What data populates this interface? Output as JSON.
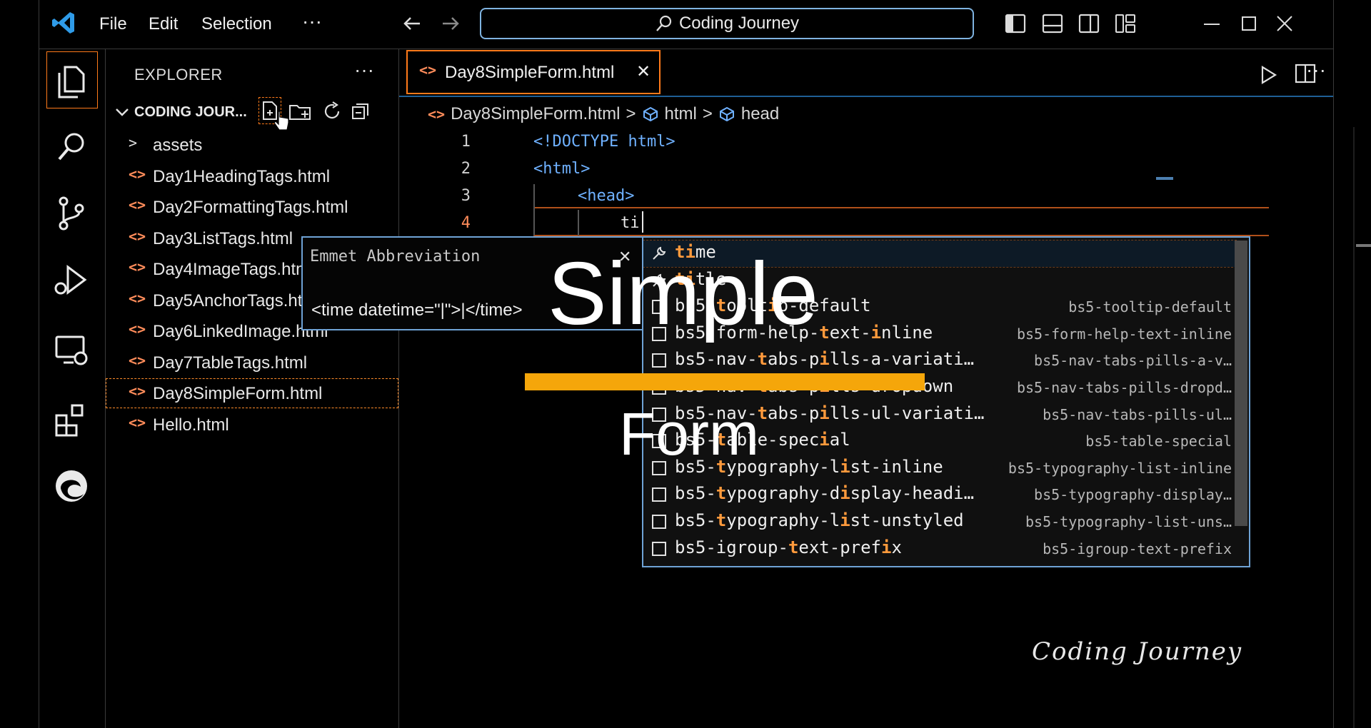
{
  "menu": {
    "file": "File",
    "edit": "Edit",
    "selection": "Selection",
    "more": "···"
  },
  "search": {
    "label": "Coding Journey"
  },
  "explorer": {
    "title": "EXPLORER",
    "more": "···",
    "workspace": "CODING JOUR...",
    "items": [
      {
        "label": "assets",
        "type": "folder"
      },
      {
        "label": "Day1HeadingTags.html",
        "type": "file"
      },
      {
        "label": "Day2FormattingTags.html",
        "type": "file"
      },
      {
        "label": "Day3ListTags.html",
        "type": "file"
      },
      {
        "label": "Day4ImageTags.html",
        "type": "file"
      },
      {
        "label": "Day5AnchorTags.html",
        "type": "file"
      },
      {
        "label": "Day6LinkedImage.html",
        "type": "file"
      },
      {
        "label": "Day7TableTags.html",
        "type": "file"
      },
      {
        "label": "Day8SimpleForm.html",
        "type": "file",
        "selected": true
      },
      {
        "label": "Hello.html",
        "type": "file"
      }
    ]
  },
  "editor": {
    "tab": {
      "label": "Day8SimpleForm.html",
      "close": "✕"
    },
    "breadcrumb": {
      "file": "Day8SimpleForm.html",
      "sep": ">",
      "node1": "html",
      "node2": "head"
    },
    "lines": [
      {
        "num": "1",
        "text": "<!DOCTYPE html>"
      },
      {
        "num": "2",
        "text": "<html>"
      },
      {
        "num": "3",
        "text": "<head>"
      },
      {
        "num": "4",
        "text": "ti"
      }
    ]
  },
  "emmet": {
    "title": "Emmet Abbreviation",
    "close": "✕",
    "preview": "<time datetime=\"|\">|</time>"
  },
  "suggestions": [
    {
      "label": "time",
      "detail": "",
      "icon": "wrench-icon"
    },
    {
      "label": "title",
      "detail": "",
      "icon": "wrench-icon"
    },
    {
      "label": "bs5-tooltip-default",
      "detail": "bs5-tooltip-default",
      "icon": "snippet-icon"
    },
    {
      "label": "bs5-form-help-text-inline",
      "detail": "bs5-form-help-text-inline",
      "icon": "snippet-icon"
    },
    {
      "label": "bs5-nav-tabs-pills-a-variati…",
      "detail": "bs5-nav-tabs-pills-a-v…",
      "icon": "snippet-icon"
    },
    {
      "label": "bs5-nav-tabs-pills-dropdown",
      "detail": "bs5-nav-tabs-pills-dropd…",
      "icon": "snippet-icon"
    },
    {
      "label": "bs5-nav-tabs-pills-ul-variati…",
      "detail": "bs5-nav-tabs-pills-ul…",
      "icon": "snippet-icon"
    },
    {
      "label": "bs5-table-special",
      "detail": "bs5-table-special",
      "icon": "snippet-icon"
    },
    {
      "label": "bs5-typography-list-inline",
      "detail": "bs5-typography-list-inline",
      "icon": "snippet-icon"
    },
    {
      "label": "bs5-typography-display-headi…",
      "detail": "bs5-typography-display…",
      "icon": "snippet-icon"
    },
    {
      "label": "bs5-typography-list-unstyled",
      "detail": "bs5-typography-list-uns…",
      "icon": "snippet-icon"
    },
    {
      "label": "bs5-igroup-text-prefix",
      "detail": "bs5-igroup-text-prefix",
      "icon": "snippet-icon"
    }
  ],
  "overlay": {
    "line1": "Simple",
    "line2": "Form",
    "accent": "#f5a60a"
  },
  "watermark": "Coding Journey",
  "colors": {
    "accent_orange": "#ff7a1a",
    "focus_blue": "#6fa3d6",
    "tag_blue": "#6fb1ff"
  }
}
